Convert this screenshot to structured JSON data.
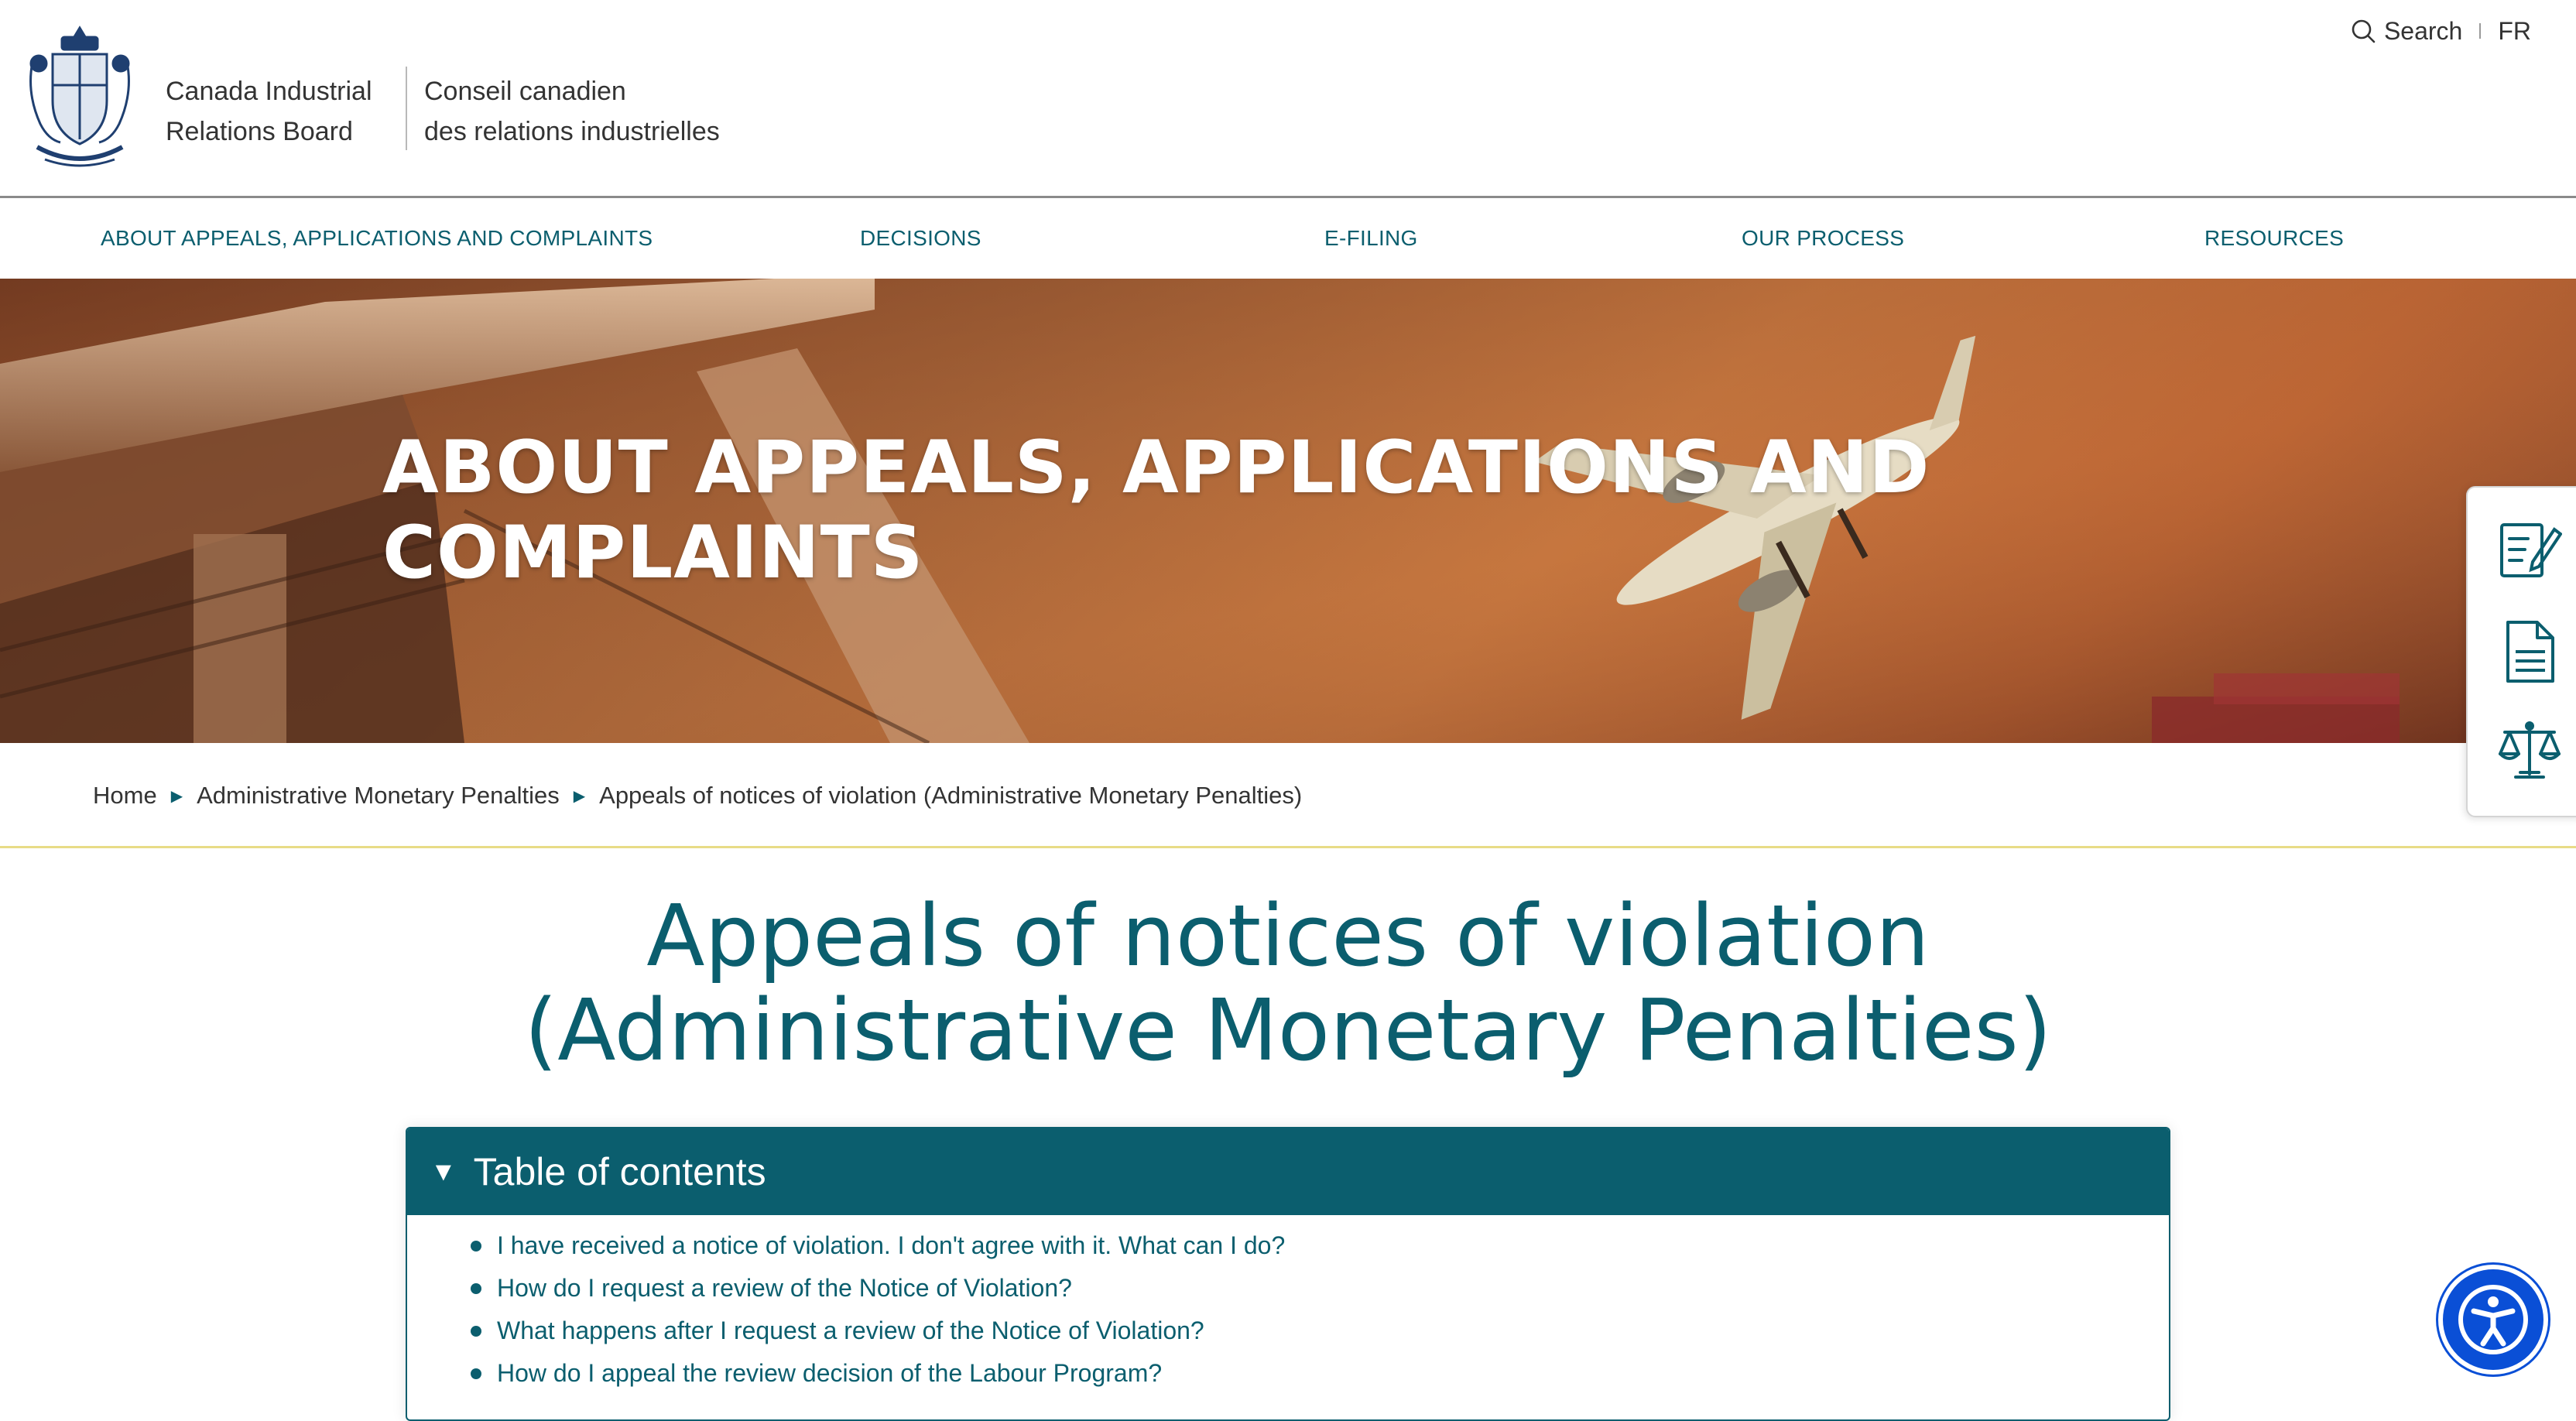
{
  "header": {
    "org_en_line1": "Canada Industrial",
    "org_en_line2": "Relations Board",
    "org_fr_line1": "Conseil canadien",
    "org_fr_line2": "des relations industrielles",
    "search_label": "Search",
    "lang_label": "FR",
    "crest_icon": "coat-of-arms-icon"
  },
  "nav": {
    "items": [
      "ABOUT APPEALS, APPLICATIONS AND COMPLAINTS",
      "DECISIONS",
      "E-FILING",
      "OUR PROCESS",
      "RESOURCES"
    ]
  },
  "hero": {
    "title_line1": "ABOUT APPEALS, APPLICATIONS AND",
    "title_line2": "COMPLAINTS"
  },
  "breadcrumb": {
    "items": [
      "Home",
      "Administrative Monetary Penalties",
      "Appeals of notices of violation (Administrative Monetary Penalties)"
    ]
  },
  "page": {
    "title_line1": "Appeals of notices of violation",
    "title_line2": "(Administrative Monetary Penalties)"
  },
  "toc": {
    "heading": "Table of contents",
    "items": [
      "I have received a notice of violation. I don't agree with it. What can I do?",
      "How do I request a review of the Notice of Violation?",
      "What happens after I request a review of the Notice of Violation?",
      "How do I appeal the review decision of the Labour Program?"
    ]
  },
  "quick_panel": {
    "icons": [
      "edit-form-icon",
      "document-icon",
      "scales-of-justice-icon"
    ]
  },
  "colors": {
    "accent_teal": "#0b5e6e",
    "breadcrumb_rule": "#e8dc86",
    "a11y_blue": "#0a4fd6"
  }
}
